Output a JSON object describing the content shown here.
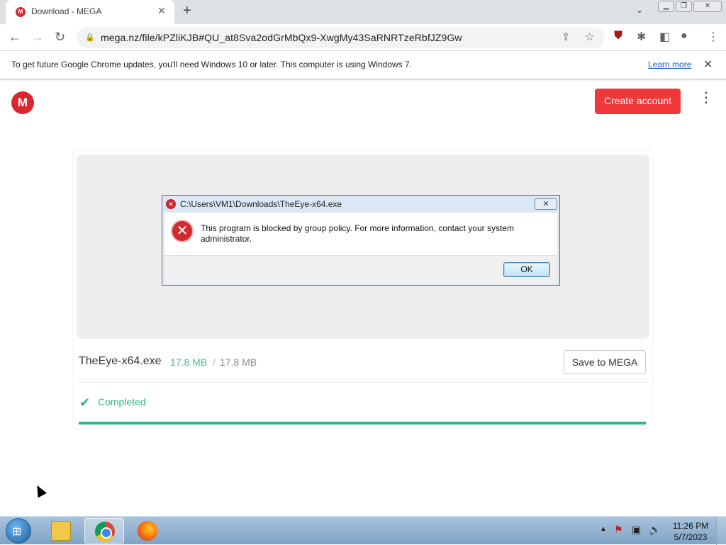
{
  "browser": {
    "tab_title": "Download - MEGA",
    "tab_favicon": "M",
    "url": "mega.nz/file/kPZliKJB#QU_at8Sva2odGrMbQx9-XwgMy43SaRNRTzeRbfJZ9Gw",
    "infobar_text": "To get future Google Chrome updates, you'll need Windows 10 or later. This computer is using Windows 7.",
    "infobar_link": "Learn more"
  },
  "page": {
    "logo_letter": "M",
    "create_account_label": "Create account",
    "file_name": "TheEye-x64.exe",
    "downloaded_size": "17.8 MB",
    "size_separator": "/",
    "total_size": "17.8 MB",
    "save_button_label": "Save to MEGA",
    "status_label": "Completed",
    "progress_fraction": 1.0,
    "accent_color": "#31b484"
  },
  "dialog": {
    "title": "C:\\Users\\VM1\\Downloads\\TheEye-x64.exe",
    "message": "This program is blocked by group policy. For more information, contact your system administrator.",
    "ok_label": "OK"
  },
  "taskbar": {
    "time": "11:26 PM",
    "date": "5/7/2023"
  }
}
